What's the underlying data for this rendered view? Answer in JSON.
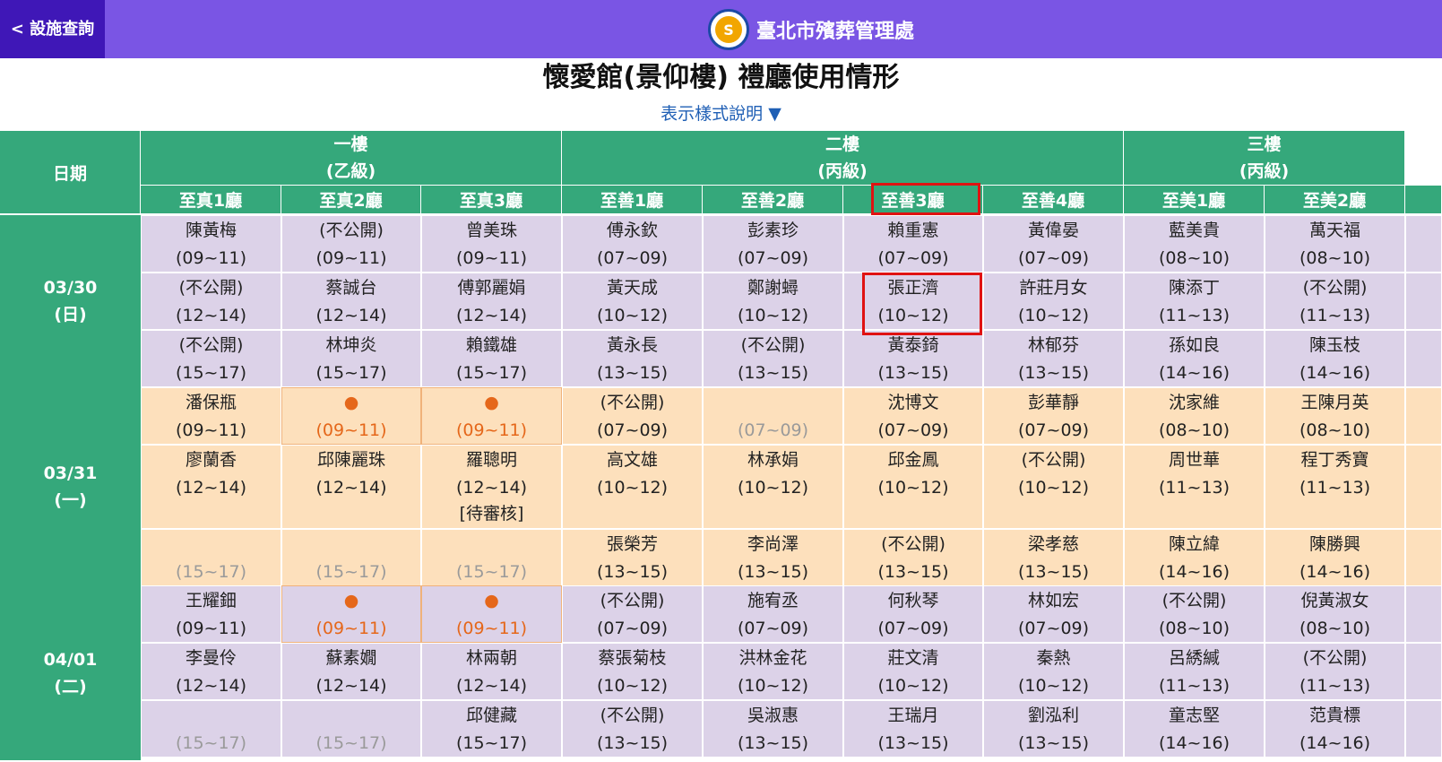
{
  "header": {
    "back_label": "< 設施查詢",
    "org_name": "臺北市殯葬管理處"
  },
  "page_title": "懷愛館(景仰樓) 禮廳使用情形",
  "legend_link": "表示樣式說明 ▼",
  "table": {
    "date_header": "日期",
    "floors": [
      {
        "name": "一樓",
        "grade": "(乙級)"
      },
      {
        "name": "二樓",
        "grade": "(丙級)"
      },
      {
        "name": "三樓",
        "grade": "(丙級)"
      }
    ],
    "halls": [
      "至真1廳",
      "至真2廳",
      "至真3廳",
      "至善1廳",
      "至善2廳",
      "至善3廳",
      "至善4廳",
      "至美1廳",
      "至美2廳"
    ],
    "days": [
      {
        "date": "03/30",
        "weekday": "(日)",
        "rows": [
          [
            {
              "name": "陳黃梅",
              "time": "(09~11)",
              "status": "booked"
            },
            {
              "name": "(不公開)",
              "time": "(09~11)",
              "status": "booked"
            },
            {
              "name": "曾美珠",
              "time": "(09~11)",
              "status": "booked"
            },
            {
              "name": "傅永欽",
              "time": "(07~09)",
              "status": "booked"
            },
            {
              "name": "彭素珍",
              "time": "(07~09)",
              "status": "booked"
            },
            {
              "name": "賴重憲",
              "time": "(07~09)",
              "status": "booked"
            },
            {
              "name": "黃偉晏",
              "time": "(07~09)",
              "status": "booked"
            },
            {
              "name": "藍美貴",
              "time": "(08~10)",
              "status": "booked"
            },
            {
              "name": "萬天福",
              "time": "(08~10)",
              "status": "booked"
            }
          ],
          [
            {
              "name": "(不公開)",
              "time": "(12~14)",
              "status": "booked"
            },
            {
              "name": "蔡誠台",
              "time": "(12~14)",
              "status": "booked"
            },
            {
              "name": "傅郭麗娟",
              "time": "(12~14)",
              "status": "booked"
            },
            {
              "name": "黃天成",
              "time": "(10~12)",
              "status": "booked"
            },
            {
              "name": "鄭謝蟳",
              "time": "(10~12)",
              "status": "booked"
            },
            {
              "name": "張正濟",
              "time": "(10~12)",
              "status": "booked"
            },
            {
              "name": "許莊月女",
              "time": "(10~12)",
              "status": "booked"
            },
            {
              "name": "陳添丁",
              "time": "(11~13)",
              "status": "booked"
            },
            {
              "name": "(不公開)",
              "time": "(11~13)",
              "status": "booked"
            }
          ],
          [
            {
              "name": "(不公開)",
              "time": "(15~17)",
              "status": "booked"
            },
            {
              "name": "林坤炎",
              "time": "(15~17)",
              "status": "booked"
            },
            {
              "name": "賴鐵雄",
              "time": "(15~17)",
              "status": "booked"
            },
            {
              "name": "黃永長",
              "time": "(13~15)",
              "status": "booked"
            },
            {
              "name": "(不公開)",
              "time": "(13~15)",
              "status": "booked"
            },
            {
              "name": "黃泰錡",
              "time": "(13~15)",
              "status": "booked"
            },
            {
              "name": "林郁芬",
              "time": "(13~15)",
              "status": "booked"
            },
            {
              "name": "孫如良",
              "time": "(14~16)",
              "status": "booked"
            },
            {
              "name": "陳玉枝",
              "time": "(14~16)",
              "status": "booked"
            }
          ]
        ]
      },
      {
        "date": "03/31",
        "weekday": "(一)",
        "rows": [
          [
            {
              "name": "潘保瓶",
              "time": "(09~11)",
              "status": "booked"
            },
            {
              "name": "●",
              "time": "(09~11)",
              "status": "available"
            },
            {
              "name": "●",
              "time": "(09~11)",
              "status": "available"
            },
            {
              "name": "(不公開)",
              "time": "(07~09)",
              "status": "booked"
            },
            {
              "name": "",
              "time": "(07~09)",
              "status": "empty"
            },
            {
              "name": "沈博文",
              "time": "(07~09)",
              "status": "booked"
            },
            {
              "name": "彭華靜",
              "time": "(07~09)",
              "status": "booked"
            },
            {
              "name": "沈家維",
              "time": "(08~10)",
              "status": "booked"
            },
            {
              "name": "王陳月英",
              "time": "(08~10)",
              "status": "booked"
            }
          ],
          [
            {
              "name": "廖蘭香",
              "time": "(12~14)",
              "status": "booked"
            },
            {
              "name": "邱陳麗珠",
              "time": "(12~14)",
              "status": "booked"
            },
            {
              "name": "羅聰明",
              "time": "(12~14)",
              "status": "booked",
              "note": "[待審核]"
            },
            {
              "name": "高文雄",
              "time": "(10~12)",
              "status": "booked"
            },
            {
              "name": "林承娟",
              "time": "(10~12)",
              "status": "booked"
            },
            {
              "name": "邱金鳳",
              "time": "(10~12)",
              "status": "booked"
            },
            {
              "name": "(不公開)",
              "time": "(10~12)",
              "status": "booked"
            },
            {
              "name": "周世華",
              "time": "(11~13)",
              "status": "booked"
            },
            {
              "name": "程丁秀寶",
              "time": "(11~13)",
              "status": "booked"
            }
          ],
          [
            {
              "name": "",
              "time": "(15~17)",
              "status": "empty"
            },
            {
              "name": "",
              "time": "(15~17)",
              "status": "empty"
            },
            {
              "name": "",
              "time": "(15~17)",
              "status": "empty"
            },
            {
              "name": "張榮芳",
              "time": "(13~15)",
              "status": "booked"
            },
            {
              "name": "李尚澤",
              "time": "(13~15)",
              "status": "booked"
            },
            {
              "name": "(不公開)",
              "time": "(13~15)",
              "status": "booked"
            },
            {
              "name": "梁孝慈",
              "time": "(13~15)",
              "status": "booked"
            },
            {
              "name": "陳立緯",
              "time": "(14~16)",
              "status": "booked"
            },
            {
              "name": "陳勝興",
              "time": "(14~16)",
              "status": "booked"
            }
          ]
        ]
      },
      {
        "date": "04/01",
        "weekday": "(二)",
        "rows": [
          [
            {
              "name": "王耀鈿",
              "time": "(09~11)",
              "status": "booked"
            },
            {
              "name": "●",
              "time": "(09~11)",
              "status": "available"
            },
            {
              "name": "●",
              "time": "(09~11)",
              "status": "available"
            },
            {
              "name": "(不公開)",
              "time": "(07~09)",
              "status": "booked"
            },
            {
              "name": "施宥丞",
              "time": "(07~09)",
              "status": "booked"
            },
            {
              "name": "何秋琴",
              "time": "(07~09)",
              "status": "booked"
            },
            {
              "name": "林如宏",
              "time": "(07~09)",
              "status": "booked"
            },
            {
              "name": "(不公開)",
              "time": "(08~10)",
              "status": "booked"
            },
            {
              "name": "倪黃淑女",
              "time": "(08~10)",
              "status": "booked"
            }
          ],
          [
            {
              "name": "李曼伶",
              "time": "(12~14)",
              "status": "booked"
            },
            {
              "name": "蘇素嫺",
              "time": "(12~14)",
              "status": "booked"
            },
            {
              "name": "林兩朝",
              "time": "(12~14)",
              "status": "booked"
            },
            {
              "name": "蔡張菊枝",
              "time": "(10~12)",
              "status": "booked"
            },
            {
              "name": "洪林金花",
              "time": "(10~12)",
              "status": "booked"
            },
            {
              "name": "莊文清",
              "time": "(10~12)",
              "status": "booked"
            },
            {
              "name": "秦熱",
              "time": "(10~12)",
              "status": "booked"
            },
            {
              "name": "呂綉緘",
              "time": "(11~13)",
              "status": "booked"
            },
            {
              "name": "(不公開)",
              "time": "(11~13)",
              "status": "booked"
            }
          ],
          [
            {
              "name": "",
              "time": "(15~17)",
              "status": "empty"
            },
            {
              "name": "",
              "time": "(15~17)",
              "status": "empty"
            },
            {
              "name": "邱健藏",
              "time": "(15~17)",
              "status": "booked"
            },
            {
              "name": "(不公開)",
              "time": "(13~15)",
              "status": "booked"
            },
            {
              "name": "吳淑惠",
              "time": "(13~15)",
              "status": "booked"
            },
            {
              "name": "王瑞月",
              "time": "(13~15)",
              "status": "booked"
            },
            {
              "name": "劉泓利",
              "time": "(13~15)",
              "status": "booked"
            },
            {
              "name": "童志堅",
              "time": "(14~16)",
              "status": "booked"
            },
            {
              "name": "范貴標",
              "time": "(14~16)",
              "status": "booked"
            }
          ]
        ]
      }
    ]
  },
  "colors": {
    "topbar": "#7a55e4",
    "back_button": "#3f17b7",
    "header_green": "#35a87b",
    "lavender_row": "#dcd2e8",
    "peach_row": "#fde0bc",
    "available_orange": "#e5671a",
    "highlight_red": "#e01212",
    "link_blue": "#1f5fb5"
  }
}
